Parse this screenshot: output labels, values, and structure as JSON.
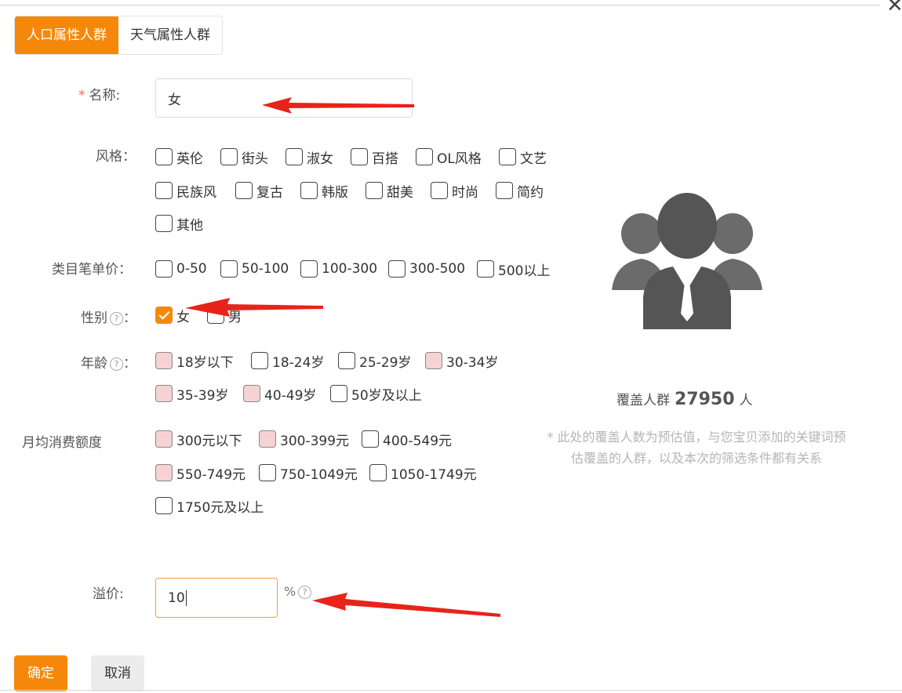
{
  "close_symbol": "✕",
  "tabs": [
    {
      "label": "人口属性人群",
      "active": true
    },
    {
      "label": "天气属性人群",
      "active": false
    }
  ],
  "name_field": {
    "required_mark": "*",
    "label": "名称:",
    "value": "女"
  },
  "style": {
    "label": "风格：",
    "options": [
      "英伦",
      "街头",
      "淑女",
      "百搭",
      "OL风格",
      "文艺",
      "民族风",
      "复古",
      "韩版",
      "甜美",
      "时尚",
      "简约",
      "其他"
    ]
  },
  "price": {
    "label": "类目笔单价：",
    "options": [
      "0-50",
      "50-100",
      "100-300",
      "300-500",
      "500以上"
    ]
  },
  "gender": {
    "label": "性别",
    "colon": "：",
    "help": "?",
    "options": [
      {
        "label": "女",
        "checked": true
      },
      {
        "label": "男",
        "checked": false
      }
    ]
  },
  "age": {
    "label": "年龄",
    "colon": "：",
    "help": "?",
    "options": [
      "18岁以下",
      "18-24岁",
      "25-29岁",
      "30-34岁",
      "35-39岁",
      "40-49岁",
      "50岁及以上"
    ]
  },
  "spend": {
    "label": "月均消费额度",
    "options": [
      "300元以下",
      "300-399元",
      "400-549元",
      "550-749元",
      "750-1049元",
      "1050-1749元",
      "1750元及以上"
    ]
  },
  "coverage": {
    "prefix": "覆盖人群",
    "count": "27950",
    "unit": "人",
    "note": "* 此处的覆盖人数为预估值，与您宝贝添加的关键词预估覆盖的人群，以及本次的筛选条件都有关系"
  },
  "premium": {
    "label": "溢价:",
    "value": "10",
    "unit": "%",
    "help": "?"
  },
  "buttons": {
    "confirm": "确定",
    "cancel": "取消"
  },
  "colors": {
    "accent": "#f5880b",
    "annotation_arrow": "#e8231b",
    "icon": "#555555"
  }
}
